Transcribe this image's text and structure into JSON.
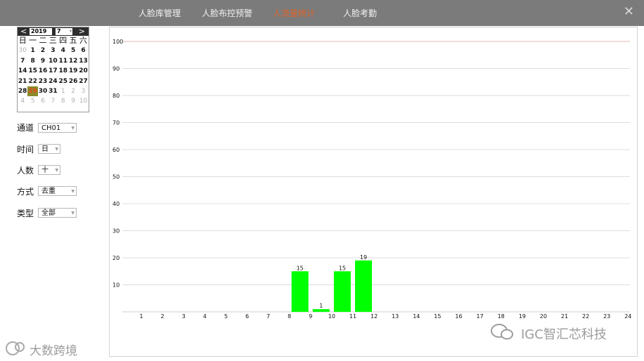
{
  "topbar": {
    "tabs": [
      {
        "label": "人脸库管理"
      },
      {
        "label": "人脸布控预警"
      },
      {
        "label": "人流量统计"
      },
      {
        "label": "人脸考勤"
      }
    ],
    "active_color": "#e0632a",
    "close_glyph": "✕"
  },
  "calendar": {
    "prev_glyph": "<",
    "next_glyph": ">",
    "year": "2019",
    "month": "7",
    "weekdays": [
      "日",
      "一",
      "二",
      "三",
      "四",
      "五",
      "六"
    ],
    "days": [
      {
        "t": "30",
        "o": true
      },
      {
        "t": "1"
      },
      {
        "t": "2"
      },
      {
        "t": "3"
      },
      {
        "t": "4"
      },
      {
        "t": "5"
      },
      {
        "t": "6"
      },
      {
        "t": "7"
      },
      {
        "t": "8"
      },
      {
        "t": "9"
      },
      {
        "t": "10"
      },
      {
        "t": "11"
      },
      {
        "t": "12"
      },
      {
        "t": "13"
      },
      {
        "t": "14"
      },
      {
        "t": "15"
      },
      {
        "t": "16"
      },
      {
        "t": "17"
      },
      {
        "t": "18"
      },
      {
        "t": "19"
      },
      {
        "t": "20"
      },
      {
        "t": "21"
      },
      {
        "t": "22"
      },
      {
        "t": "23"
      },
      {
        "t": "24"
      },
      {
        "t": "25"
      },
      {
        "t": "26"
      },
      {
        "t": "27"
      },
      {
        "t": "28"
      },
      {
        "t": "29",
        "sel": true
      },
      {
        "t": "30"
      },
      {
        "t": "31"
      },
      {
        "t": "1",
        "o": true
      },
      {
        "t": "2",
        "o": true
      },
      {
        "t": "3",
        "o": true
      },
      {
        "t": "4",
        "o": true
      },
      {
        "t": "5",
        "o": true
      },
      {
        "t": "6",
        "o": true
      },
      {
        "t": "7",
        "o": true
      },
      {
        "t": "8",
        "o": true
      },
      {
        "t": "9",
        "o": true
      },
      {
        "t": "10",
        "o": true
      }
    ]
  },
  "filters": {
    "channel": {
      "label": "通道",
      "value": "CH01"
    },
    "time": {
      "label": "时间",
      "value": "日"
    },
    "count": {
      "label": "人数",
      "value": "十"
    },
    "mode": {
      "label": "方式",
      "value": "去重"
    },
    "type": {
      "label": "类型",
      "value": "全部"
    }
  },
  "chart_data": {
    "type": "bar",
    "categories": [
      "1",
      "2",
      "3",
      "4",
      "5",
      "6",
      "7",
      "8",
      "9",
      "10",
      "11",
      "12",
      "13",
      "14",
      "15",
      "16",
      "17",
      "18",
      "19",
      "20",
      "21",
      "22",
      "23",
      "24"
    ],
    "values": [
      0,
      0,
      0,
      0,
      0,
      0,
      0,
      0,
      15,
      1,
      15,
      19,
      0,
      0,
      0,
      0,
      0,
      0,
      0,
      0,
      0,
      0,
      0,
      0
    ],
    "y_ticks": [
      "10",
      "20",
      "30",
      "40",
      "50",
      "60",
      "70",
      "80",
      "90",
      "100"
    ],
    "ylim": [
      0,
      100
    ],
    "bar_color": "#00ff00",
    "grid": true,
    "title": "",
    "xlabel": "",
    "ylabel": ""
  },
  "watermarks": {
    "left_text": "大数跨境",
    "right_text": "IGC智汇芯科技"
  }
}
